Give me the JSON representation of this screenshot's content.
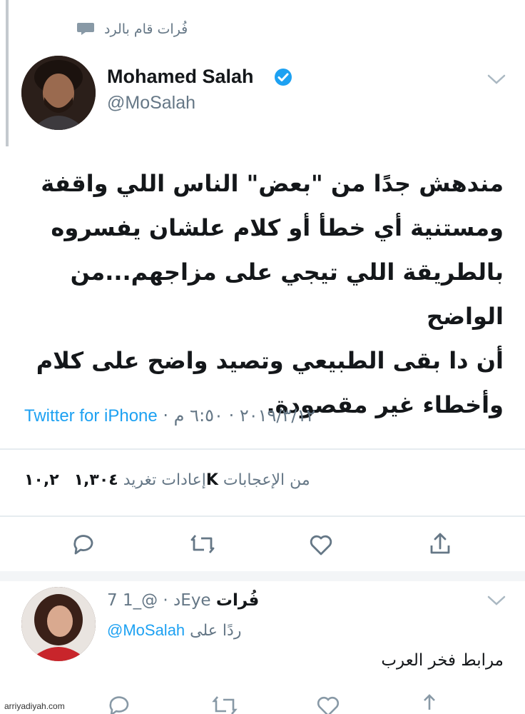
{
  "context": {
    "text": "فُرات قام بالرد",
    "icon": "reply-bubble-icon"
  },
  "tweet": {
    "author_name": "Mohamed Salah",
    "author_handle": "@MoSalah",
    "verified": true,
    "text_lines": [
      "مندهش جدًا من \"بعض\" الناس اللي واقفة",
      "ومستنية أي خطأ أو كلام علشان يفسروه",
      "بالطريقة اللي تيجي على مزاجهم...من الواضح",
      "أن دا بقى الطبيعي وتصيد واضح على كلام",
      "وأخطاء غير مقصودة."
    ],
    "time": "٦:٥٠ م",
    "date": "٢٠١٩/٣/١٢",
    "separator": "·",
    "client": "Twitter for iPhone",
    "retweets_count": "١,٣٠٤",
    "retweets_label": "إعادات تغريد",
    "likes_count": "١٠,٢K",
    "likes_label": "من الإعجابات",
    "actions": [
      "reply-icon",
      "retweet-icon",
      "like-icon",
      "share-icon"
    ]
  },
  "reply": {
    "name": "فُرات",
    "handle": "@_1Eye",
    "age": "7 د",
    "separator": "·",
    "replying_to_label": "ردًا على",
    "replying_to_handle": "@MoSalah",
    "text": "مرابط فخر العرب"
  },
  "watermark": "arriyadiyah.com",
  "colors": {
    "accent": "#1da1f2",
    "muted": "#657786",
    "text": "#14171a"
  }
}
